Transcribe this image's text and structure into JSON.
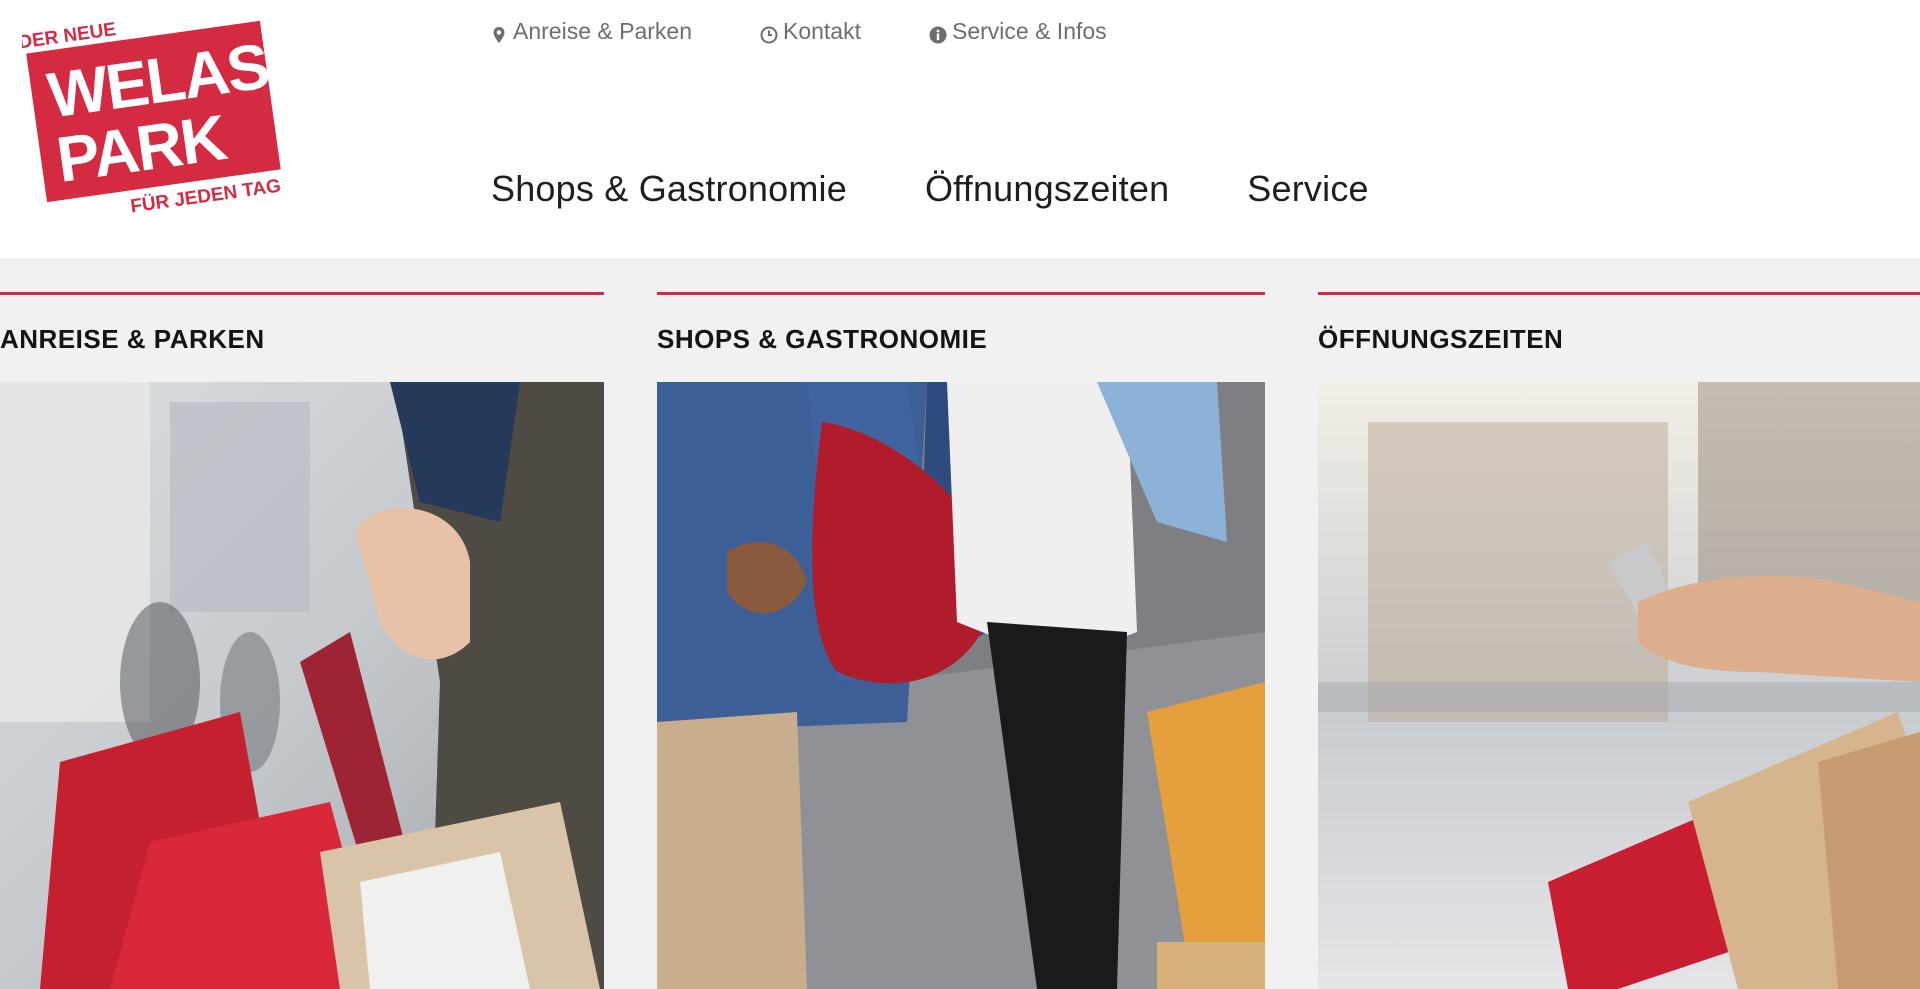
{
  "brand": {
    "logo_top": "DER NEUE",
    "logo_line1": "WELAS",
    "logo_line2": "PARK",
    "logo_bottom": "FÜR JEDEN TAG",
    "accent": "#d52b42"
  },
  "topbar": {
    "items": [
      {
        "icon": "map-pin-icon",
        "label": "Anreise & Parken"
      },
      {
        "icon": "clock-icon",
        "label": "Kontakt"
      },
      {
        "icon": "info-icon",
        "label": "Service & Infos"
      }
    ]
  },
  "mainnav": {
    "items": [
      {
        "label": "Shops & Gastronomie"
      },
      {
        "label": "Öffnungszeiten"
      },
      {
        "label": "Service"
      }
    ]
  },
  "cards": [
    {
      "title": "ANREISE & PARKEN"
    },
    {
      "title": "SHOPS & GASTRONOMIE"
    },
    {
      "title": "ÖFFNUNGSZEITEN"
    }
  ]
}
